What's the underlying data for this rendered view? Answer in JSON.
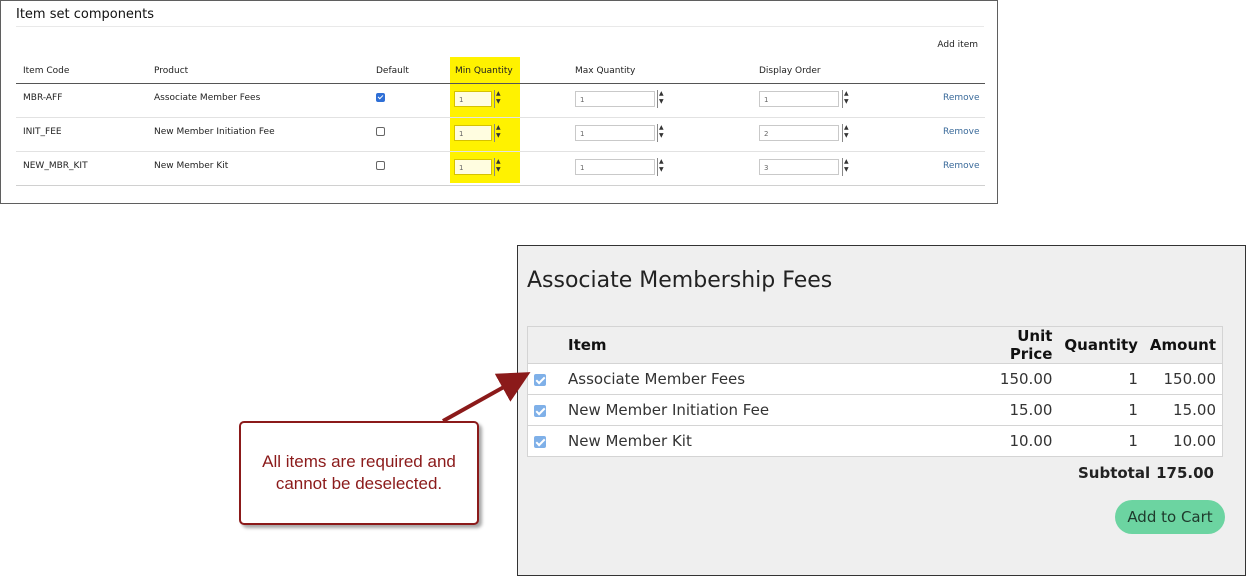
{
  "admin": {
    "title": "Item set components",
    "add_item": "Add item",
    "headers": {
      "item_code": "Item Code",
      "product": "Product",
      "default": "Default",
      "min_quantity": "Min Quantity",
      "max_quantity": "Max Quantity",
      "display_order": "Display Order"
    },
    "remove_label": "Remove",
    "rows": [
      {
        "code": "MBR-AFF",
        "product": "Associate Member Fees",
        "default_checked": true,
        "min": "1",
        "max": "1",
        "order": "1"
      },
      {
        "code": "INIT_FEE",
        "product": "New Member Initiation Fee",
        "default_checked": false,
        "min": "1",
        "max": "1",
        "order": "2"
      },
      {
        "code": "NEW_MBR_KIT",
        "product": "New Member Kit",
        "default_checked": false,
        "min": "1",
        "max": "1",
        "order": "3"
      }
    ],
    "highlight_color": "#fff200"
  },
  "store": {
    "title": "Associate Membership Fees",
    "headers": {
      "item": "Item",
      "unit_price": "Unit Price",
      "quantity": "Quantity",
      "amount": "Amount"
    },
    "rows": [
      {
        "item": "Associate Member Fees",
        "unit_price": "150.00",
        "quantity": "1",
        "amount": "150.00",
        "checked": true
      },
      {
        "item": "New Member Initiation Fee",
        "unit_price": "15.00",
        "quantity": "1",
        "amount": "15.00",
        "checked": true
      },
      {
        "item": "New Member Kit",
        "unit_price": "10.00",
        "quantity": "1",
        "amount": "10.00",
        "checked": true
      }
    ],
    "subtotal_label": "Subtotal",
    "subtotal_value": "175.00",
    "add_to_cart": "Add to Cart",
    "button_color": "#6cd4a1"
  },
  "callout": {
    "line1": "All items are required and",
    "line2": "cannot be deselected.",
    "color": "#8b1a1a"
  }
}
